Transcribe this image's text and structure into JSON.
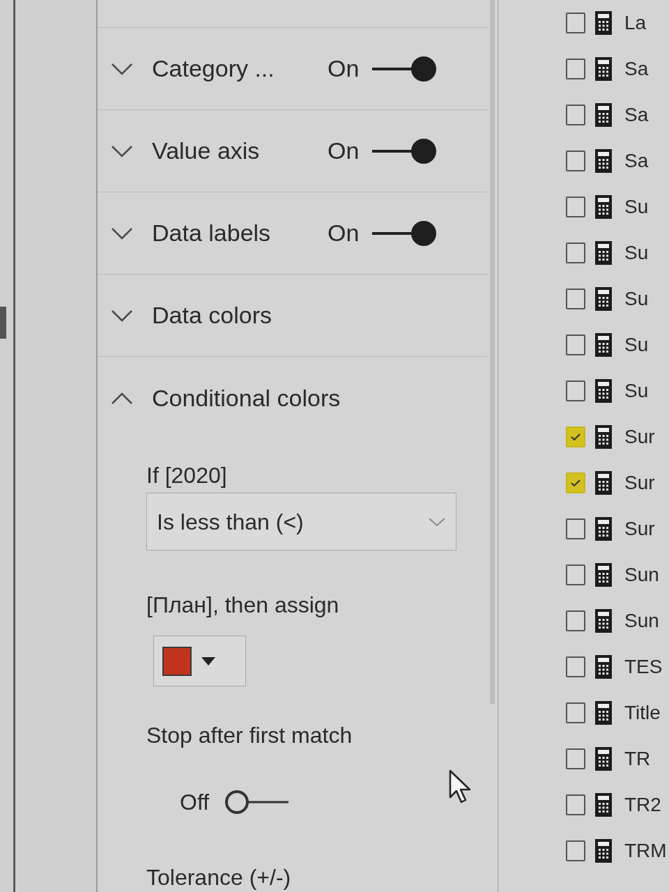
{
  "format_pane": {
    "sections": [
      {
        "title": "Category ...",
        "expanded": false,
        "toggle": {
          "label": "On",
          "on": true
        }
      },
      {
        "title": "Value axis",
        "expanded": false,
        "toggle": {
          "label": "On",
          "on": true
        }
      },
      {
        "title": "Data labels",
        "expanded": false,
        "toggle": {
          "label": "On",
          "on": true
        }
      },
      {
        "title": "Data colors",
        "expanded": false
      },
      {
        "title": "Conditional colors",
        "expanded": true
      }
    ]
  },
  "conditional_colors": {
    "if_label": "If [2020]",
    "operator": {
      "value": "Is less than (<)"
    },
    "then_label": "[План], then assign",
    "assign_color": {
      "color": "#c0341d"
    },
    "stop_after_first_match": {
      "label": "Stop after first match",
      "toggle": {
        "label": "Off",
        "on": false
      }
    },
    "tolerance_label": "Tolerance (+/-)"
  },
  "fields": [
    {
      "name": "La",
      "checked": false
    },
    {
      "name": "Sa",
      "checked": false
    },
    {
      "name": "Sa",
      "checked": false
    },
    {
      "name": "Sa",
      "checked": false
    },
    {
      "name": "Su",
      "checked": false
    },
    {
      "name": "Su",
      "checked": false
    },
    {
      "name": "Su",
      "checked": false
    },
    {
      "name": "Su",
      "checked": false
    },
    {
      "name": "Su",
      "checked": false
    },
    {
      "name": "Sur",
      "checked": true
    },
    {
      "name": "Sur",
      "checked": true
    },
    {
      "name": "Sur",
      "checked": false
    },
    {
      "name": "Sun",
      "checked": false
    },
    {
      "name": "Sun",
      "checked": false
    },
    {
      "name": "TES",
      "checked": false
    },
    {
      "name": "Title",
      "checked": false
    },
    {
      "name": "TR",
      "checked": false
    },
    {
      "name": "TR2",
      "checked": false
    },
    {
      "name": "TRM",
      "checked": false
    }
  ]
}
